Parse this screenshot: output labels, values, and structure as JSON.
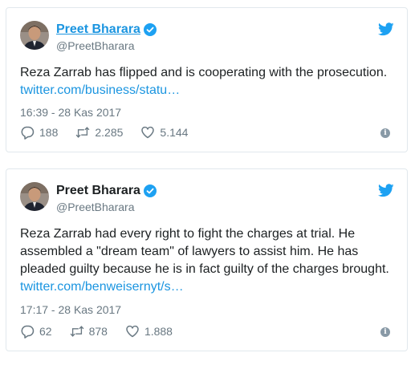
{
  "colors": {
    "link": "#1b95e0",
    "text": "#1c2022",
    "muted": "#697882",
    "border": "#e1e8ed",
    "twitter_blue": "#1da1f2"
  },
  "tweets": [
    {
      "name": "Preet Bharara",
      "handle": "@PreetBharara",
      "text": "Reza Zarrab has flipped and is cooperating with the prosecution.",
      "link": "twitter.com/business/statu…",
      "timestamp": "16:39 - 28 Kas 2017",
      "replies": "188",
      "retweets": "2.285",
      "likes": "5.144",
      "icons": [
        "reply-icon",
        "retweet-icon",
        "like-icon",
        "info-icon",
        "twitter-bird-icon",
        "verified-icon"
      ]
    },
    {
      "name": "Preet Bharara",
      "handle": "@PreetBharara",
      "text": "Reza Zarrab had every right to fight the charges at trial. He assembled a \"dream team\" of lawyers to assist him. He has pleaded guilty because he is in fact guilty of the charges brought.",
      "link": "twitter.com/benweisernyt/s…",
      "timestamp": "17:17 - 28 Kas 2017",
      "replies": "62",
      "retweets": "878",
      "likes": "1.888",
      "icons": [
        "reply-icon",
        "retweet-icon",
        "like-icon",
        "info-icon",
        "twitter-bird-icon",
        "verified-icon"
      ]
    }
  ]
}
